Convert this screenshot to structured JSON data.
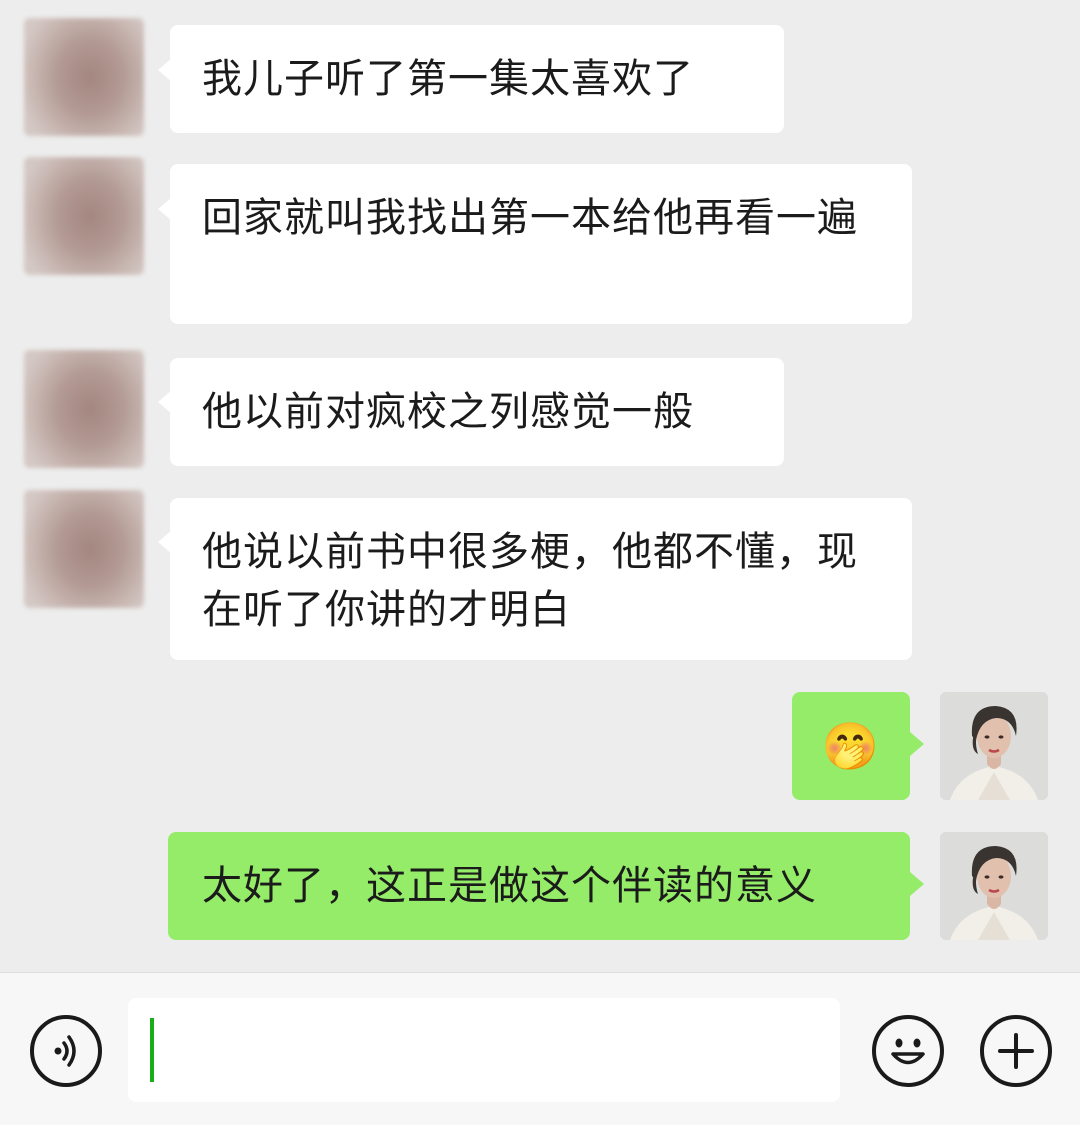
{
  "messages": [
    {
      "side": "in",
      "text": "我儿子听了第一集太喜欢了"
    },
    {
      "side": "in",
      "text": "回家就叫我找出第一本给他再看一遍"
    },
    {
      "side": "in",
      "text": "他以前对疯校之列感觉一般"
    },
    {
      "side": "in",
      "text": "他说以前书中很多梗，他都不懂，现在听了你讲的才明白"
    },
    {
      "side": "out",
      "emoji": "🤭"
    },
    {
      "side": "out",
      "text": "太好了，这正是做这个伴读的意义"
    }
  ],
  "input": {
    "value": ""
  },
  "icons": {
    "voice": "voice-input-icon",
    "emoji": "emoji-icon",
    "plus": "plus-icon"
  },
  "colors": {
    "background": "#ededed",
    "incoming_bubble": "#ffffff",
    "outgoing_bubble": "#95ec69",
    "caret": "#1aad19"
  }
}
